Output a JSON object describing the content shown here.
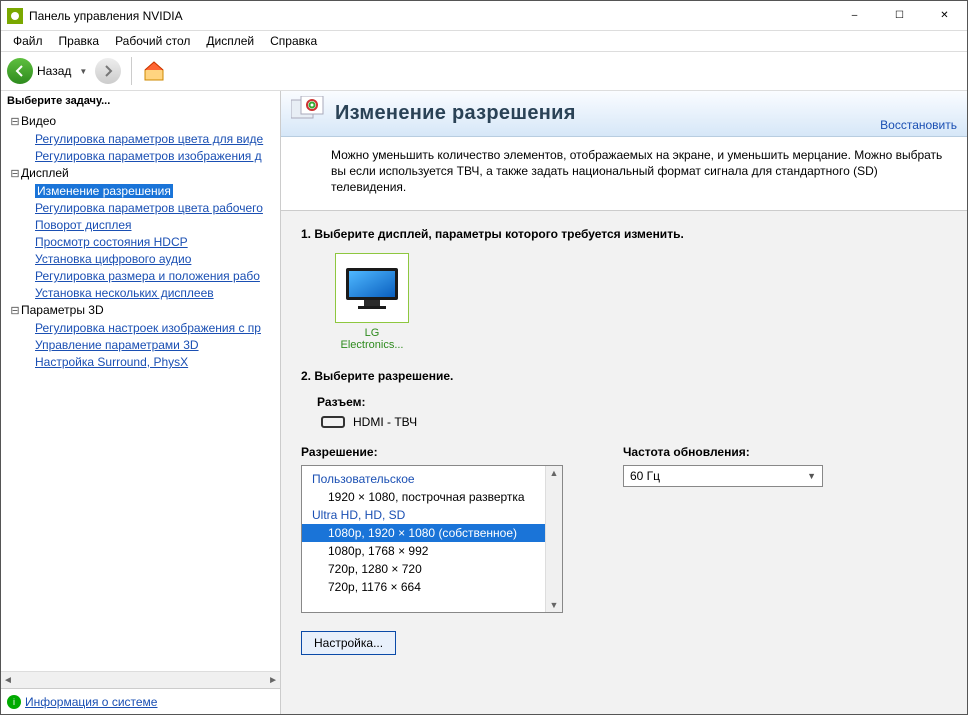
{
  "window": {
    "title": "Панель управления NVIDIA"
  },
  "menu": [
    "Файл",
    "Правка",
    "Рабочий стол",
    "Дисплей",
    "Справка"
  ],
  "toolbar": {
    "back": "Назад"
  },
  "sidebar": {
    "header": "Выберите задачу...",
    "video_label": "Видео",
    "video_items": [
      "Регулировка параметров цвета для виде",
      "Регулировка параметров изображения д"
    ],
    "display_label": "Дисплей",
    "display_items": [
      "Изменение разрешения",
      "Регулировка параметров цвета рабочего",
      "Поворот дисплея",
      "Просмотр состояния HDCP",
      "Установка цифрового аудио",
      "Регулировка размера и положения рабо",
      "Установка нескольких дисплеев"
    ],
    "params3d_label": "Параметры 3D",
    "params3d_items": [
      "Регулировка настроек изображения с пр",
      "Управление параметрами 3D",
      "Настройка Surround, PhysX"
    ],
    "sysinfo": "Информация о системе"
  },
  "page": {
    "title": "Изменение разрешения",
    "restore": "Восстановить",
    "description": "Можно уменьшить количество элементов, отображаемых на экране, и уменьшить мерцание. Можно выбрать вы если используется ТВЧ, а также задать национальный формат сигнала для стандартного (SD) телевидения.",
    "step1": "1. Выберите дисплей, параметры которого требуется изменить.",
    "display_name": "LG Electronics...",
    "step2": "2. Выберите разрешение.",
    "connector_label": "Разъем:",
    "connector_value": "HDMI - ТВЧ",
    "resolution_label": "Разрешение:",
    "refresh_label": "Частота обновления:",
    "refresh_value": "60 Гц",
    "res_group1": "Пользовательское",
    "res_custom1": "1920 × 1080, построчная развертка",
    "res_group2": "Ultra HD, HD, SD",
    "res_items": [
      "1080p, 1920 × 1080 (собственное)",
      "1080p, 1768 × 992",
      "720p, 1280 × 720",
      "720p, 1176 × 664"
    ],
    "config_btn": "Настройка..."
  }
}
